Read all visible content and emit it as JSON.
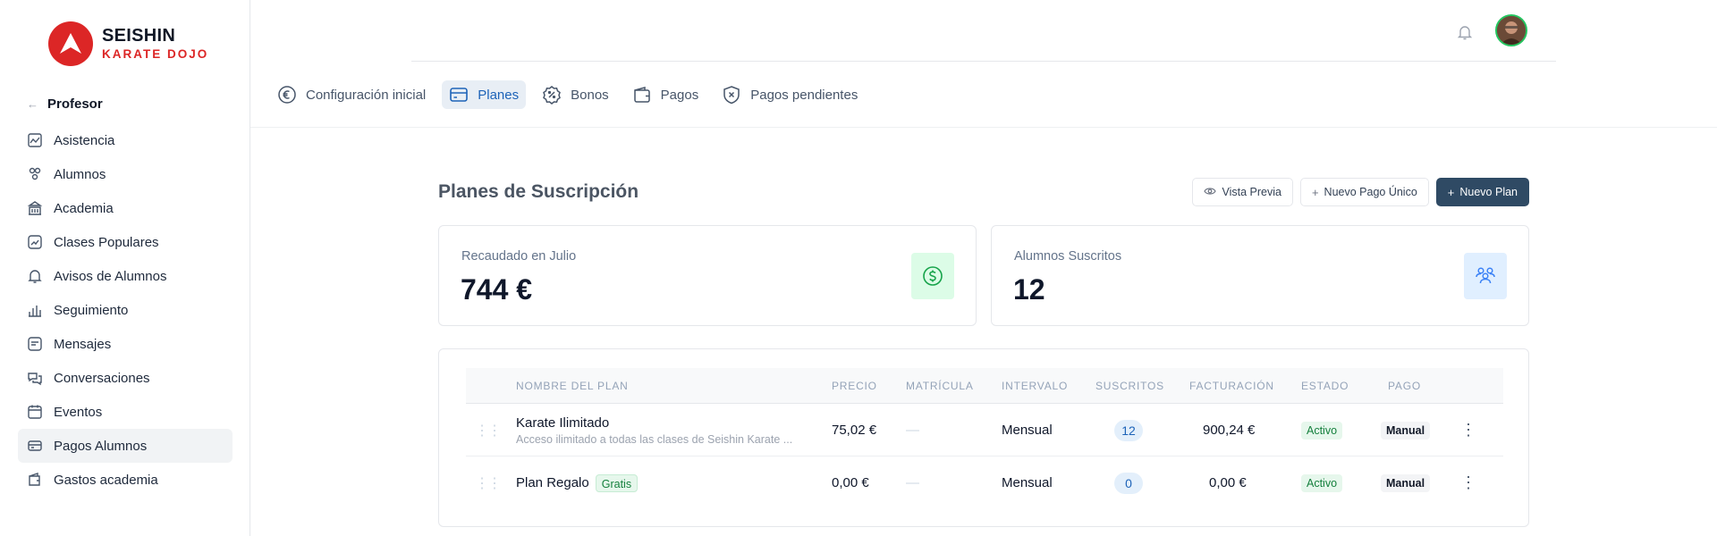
{
  "brand": {
    "name": "SEISHIN",
    "subtitle": "KARATE DOJO",
    "color": "#dc2626"
  },
  "sidebar": {
    "back_label": "Profesor",
    "items": [
      {
        "label": "Asistencia",
        "icon": "chart-line-icon"
      },
      {
        "label": "Alumnos",
        "icon": "users-icon"
      },
      {
        "label": "Academia",
        "icon": "building-icon"
      },
      {
        "label": "Clases Populares",
        "icon": "trending-icon"
      },
      {
        "label": "Avisos de Alumnos",
        "icon": "bell-icon"
      },
      {
        "label": "Seguimiento",
        "icon": "bar-chart-icon"
      },
      {
        "label": "Mensajes",
        "icon": "message-icon"
      },
      {
        "label": "Conversaciones",
        "icon": "chat-icon"
      },
      {
        "label": "Eventos",
        "icon": "calendar-icon"
      },
      {
        "label": "Pagos Alumnos",
        "icon": "credit-card-icon",
        "active": true
      },
      {
        "label": "Gastos academia",
        "icon": "wallet-icon"
      }
    ]
  },
  "tabs": [
    {
      "label": "Configuración inicial",
      "icon": "euro-icon"
    },
    {
      "label": "Planes",
      "icon": "credit-card-icon",
      "active": true
    },
    {
      "label": "Bonos",
      "icon": "discount-icon"
    },
    {
      "label": "Pagos",
      "icon": "wallet-icon"
    },
    {
      "label": "Pagos pendientes",
      "icon": "shield-x-icon"
    }
  ],
  "page": {
    "title": "Planes de Suscripción",
    "buttons": {
      "preview": "Vista Previa",
      "single_payment": "Nuevo Pago Único",
      "new_plan": "Nuevo Plan"
    }
  },
  "stats": [
    {
      "label": "Recaudado en Julio",
      "value": "744 €",
      "icon": "dollar-circle-icon",
      "color": "#16a34a"
    },
    {
      "label": "Alumnos Suscritos",
      "value": "12",
      "icon": "users-icon",
      "color": "#3b82f6"
    }
  ],
  "table": {
    "columns": [
      "Nombre del plan",
      "Precio",
      "Matrícula",
      "Intervalo",
      "Suscritos",
      "Facturación",
      "Estado",
      "Pago"
    ],
    "rows": [
      {
        "name": "Karate Ilimitado",
        "description": "Acceso ilimitado a todas las clases de Seishin Karate ...",
        "tag": "",
        "price": "75,02 €",
        "enrollment": "—",
        "interval": "Mensual",
        "subscribers": "12",
        "billing": "900,24 €",
        "status": "Activo",
        "payment": "Manual"
      },
      {
        "name": "Plan Regalo",
        "description": "",
        "tag": "Gratis",
        "price": "0,00 €",
        "enrollment": "—",
        "interval": "Mensual",
        "subscribers": "0",
        "billing": "0,00 €",
        "status": "Activo",
        "payment": "Manual"
      }
    ]
  }
}
